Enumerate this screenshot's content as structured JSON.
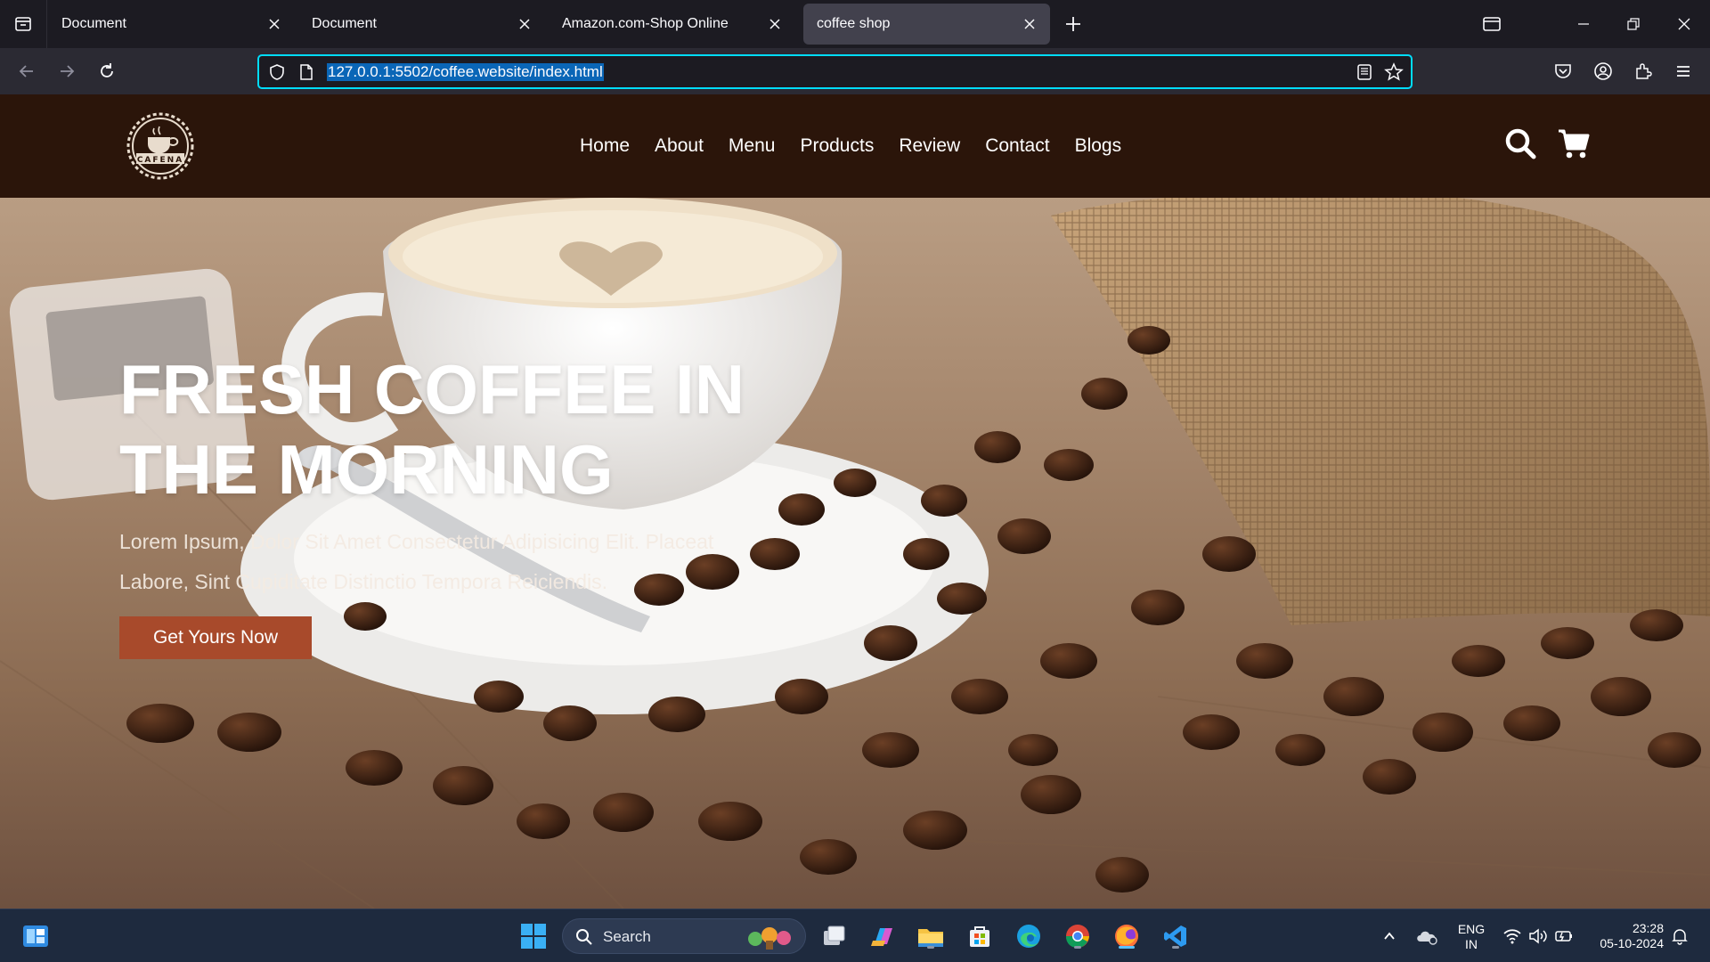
{
  "browser": {
    "tabs": [
      {
        "title": "Document",
        "active": false
      },
      {
        "title": "Document",
        "active": false
      },
      {
        "title": "Amazon.com-Shop Online",
        "active": false
      },
      {
        "title": "coffee shop",
        "active": true
      }
    ],
    "url": "127.0.0.1:5502/coffee.website/index.html"
  },
  "site": {
    "logo_text": "CAFENA",
    "nav": [
      "Home",
      "About",
      "Menu",
      "Products",
      "Review",
      "Contact",
      "Blogs"
    ],
    "hero": {
      "title": "Fresh Coffee In The Morning",
      "text": "Lorem Ipsum, Dolor Sit Amet Consectetur Adipisicing Elit. Placeat Labore, Sint Cupiditate Distinctio Tempora Reiciendis.",
      "cta": "Get Yours Now"
    },
    "colors": {
      "header": "#2b150a",
      "cta": "#a84a2b",
      "accent": "#00ddff"
    }
  },
  "taskbar": {
    "search_label": "Search",
    "lang_top": "ENG",
    "lang_bottom": "IN",
    "time": "23:28",
    "date": "05-10-2024"
  }
}
